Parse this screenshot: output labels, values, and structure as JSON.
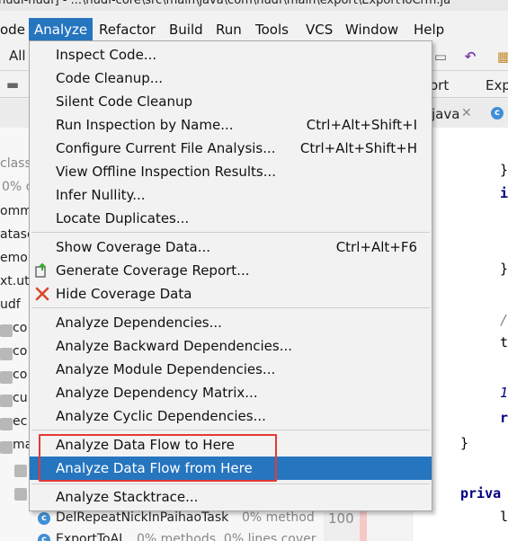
{
  "window": {
    "title": "nudf-nudf] - ...\\nudf-core\\src\\main\\java\\com\\nudf\\main\\export\\ExportToCrm.ja"
  },
  "menubar": [
    {
      "label": "ode"
    },
    {
      "label": "Analyze"
    },
    {
      "label": "Refactor"
    },
    {
      "label": "Build"
    },
    {
      "label": "Run"
    },
    {
      "label": "Tools"
    },
    {
      "label": "VCS"
    },
    {
      "label": "Window"
    },
    {
      "label": "Help"
    }
  ],
  "analyze_menu": {
    "groups": [
      [
        {
          "label": "Inspect Code...",
          "shortcut": ""
        },
        {
          "label": "Code Cleanup...",
          "shortcut": ""
        },
        {
          "label": "Silent Code Cleanup",
          "shortcut": ""
        },
        {
          "label": "Run Inspection by Name...",
          "shortcut": "Ctrl+Alt+Shift+I"
        },
        {
          "label": "Configure Current File Analysis...",
          "shortcut": "Ctrl+Alt+Shift+H"
        },
        {
          "label": "View Offline Inspection Results...",
          "shortcut": ""
        },
        {
          "label": "Infer Nullity...",
          "shortcut": ""
        },
        {
          "label": "Locate Duplicates...",
          "shortcut": ""
        }
      ],
      [
        {
          "label": "Show Coverage Data...",
          "shortcut": "Ctrl+Alt+F6"
        },
        {
          "label": "Generate Coverage Report...",
          "shortcut": "",
          "icon": "generate-coverage-icon"
        },
        {
          "label": "Hide Coverage Data",
          "shortcut": "",
          "icon": "hide-coverage-icon"
        }
      ],
      [
        {
          "label": "Analyze Dependencies...",
          "shortcut": ""
        },
        {
          "label": "Analyze Backward Dependencies...",
          "shortcut": ""
        },
        {
          "label": "Analyze Module Dependencies...",
          "shortcut": ""
        },
        {
          "label": "Analyze Dependency Matrix...",
          "shortcut": ""
        },
        {
          "label": "Analyze Cyclic Dependencies...",
          "shortcut": ""
        }
      ],
      [
        {
          "label": "Analyze Data Flow to Here",
          "shortcut": ""
        },
        {
          "label": "Analyze Data Flow from Here",
          "shortcut": "",
          "selected": true
        }
      ],
      [
        {
          "label": "Analyze Stacktrace...",
          "shortcut": ""
        }
      ]
    ]
  },
  "background": {
    "toolbar": {
      "all_label": "All"
    },
    "breadcrumb": {
      "item1": "ort",
      "item2": "Exp"
    },
    "tabs": {
      "tab1": "java"
    },
    "left_panel": {
      "lines": [
        "class",
        "0% c",
        "omm",
        "atasc",
        "emo",
        "xt.ut",
        "udf",
        "co",
        "co",
        "co",
        "cu",
        "ec",
        "ma"
      ],
      "rows": [
        {
          "name": "DelRepeatNickInPaihaoTask",
          "coverage": "0% method",
          "line": "100"
        },
        {
          "name": "ExportToAL",
          "coverage": "0% methods, 0% lines cover",
          "line": "101"
        }
      ]
    },
    "editor": {
      "lines": [
        "}",
        "i",
        "}",
        "/",
        "t",
        "1",
        "r",
        "}",
        "priva",
        "l"
      ]
    }
  },
  "colors": {
    "accent": "#2675bf",
    "annotation_box": "#e53935"
  }
}
